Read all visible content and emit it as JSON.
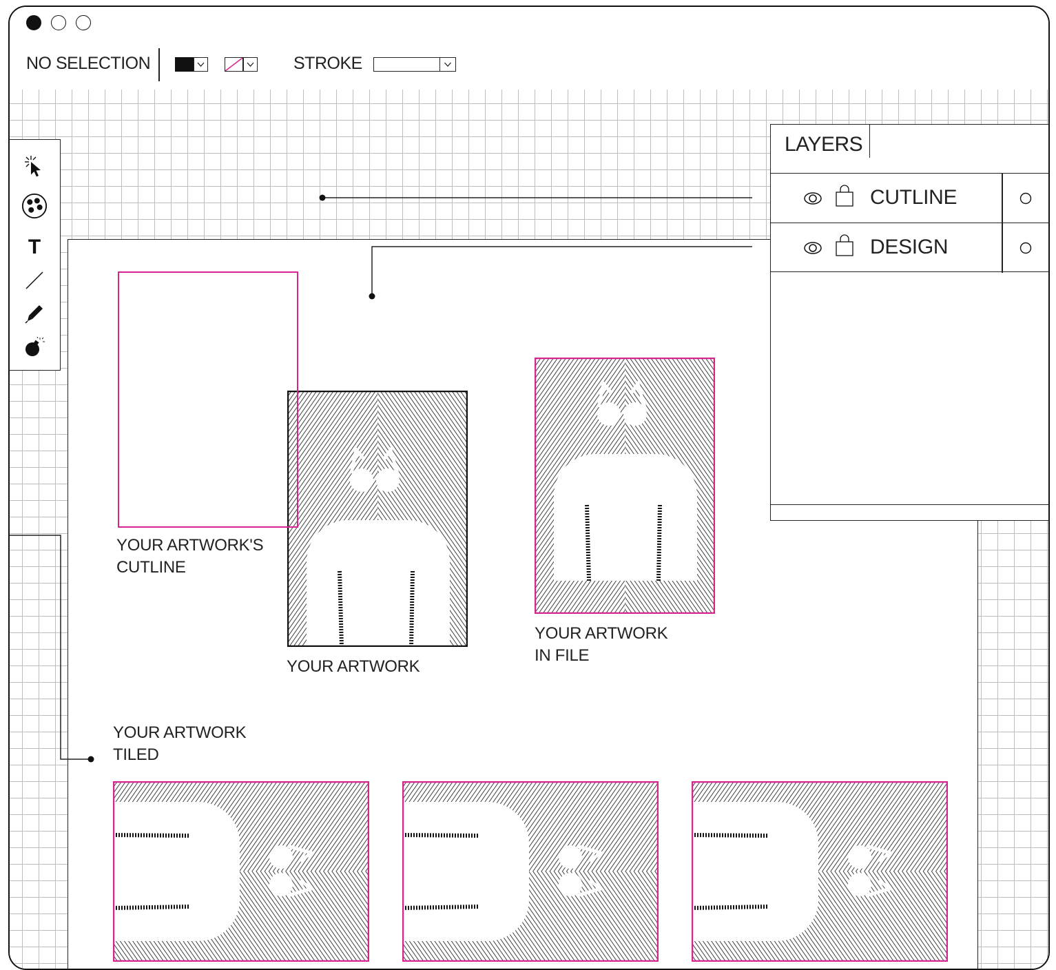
{
  "toolbar": {
    "selection_status": "NO SELECTION",
    "stroke_label": "STROKE"
  },
  "tools": [
    "select-tool-icon",
    "color-palette-icon",
    "text-tool-icon",
    "line-tool-icon",
    "pen-tool-icon",
    "bomb-icon"
  ],
  "tools_text_glyph": "T",
  "layers_panel": {
    "title": "LAYERS",
    "layers": [
      {
        "name": "CUTLINE"
      },
      {
        "name": "DESIGN"
      }
    ]
  },
  "artboard": {
    "cutline_label": "YOUR ARTWORK'S\nCUTLINE",
    "artwork_label": "YOUR ARTWORK",
    "artwork_in_file_label": "YOUR ARTWORK\nIN FILE",
    "tiled_label": "YOUR ARTWORK\nTILED"
  },
  "colors": {
    "cutline": "#d6258f",
    "ink": "#111111",
    "grid": "#bdbdbd"
  }
}
